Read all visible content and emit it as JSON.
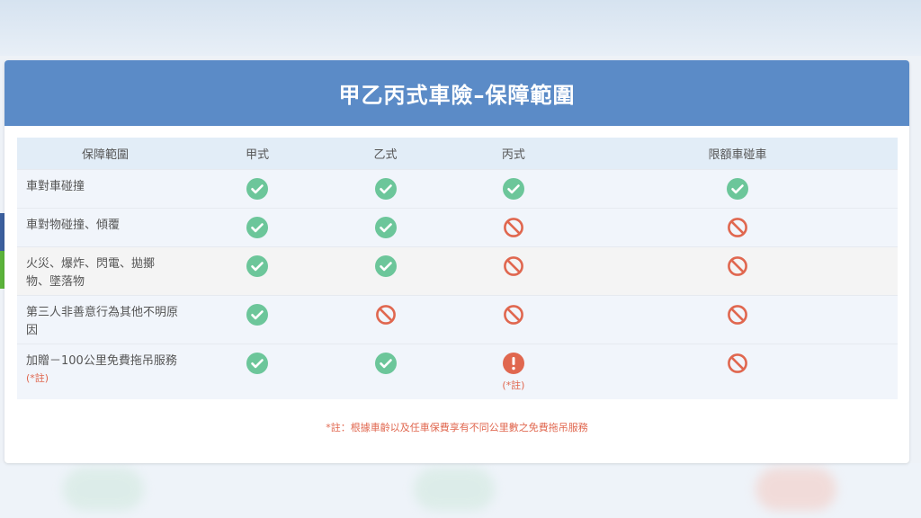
{
  "title": "甲乙丙式車險–保障範圍",
  "headers": [
    "保障範圍",
    "甲式",
    "乙式",
    "丙式",
    "限額車碰車"
  ],
  "rows": [
    {
      "label": "車對車碰撞",
      "cells": [
        "check",
        "check",
        "check",
        "check"
      ]
    },
    {
      "label": "車對物碰撞、傾覆",
      "cells": [
        "check",
        "check",
        "no",
        "no"
      ]
    },
    {
      "label": "火災、爆炸、閃電、拋擲物、墜落物",
      "cells": [
        "check",
        "check",
        "no",
        "no"
      ]
    },
    {
      "label": "第三人非善意行為其他不明原因",
      "cells": [
        "check",
        "no",
        "no",
        "no"
      ]
    },
    {
      "label": "加贈－100公里免費拖吊服務",
      "label_note": "(*註)",
      "cells": [
        "check",
        "check",
        "alert",
        "no"
      ],
      "alert_note": "(*註)"
    }
  ],
  "footnote": "*註：根據車齡以及任車保費享有不同公里數之免費拖吊服務",
  "colors": {
    "header": "#5b8bc7",
    "check": "#6cc69a",
    "no": "#e0674f",
    "alert": "#e0674f"
  }
}
